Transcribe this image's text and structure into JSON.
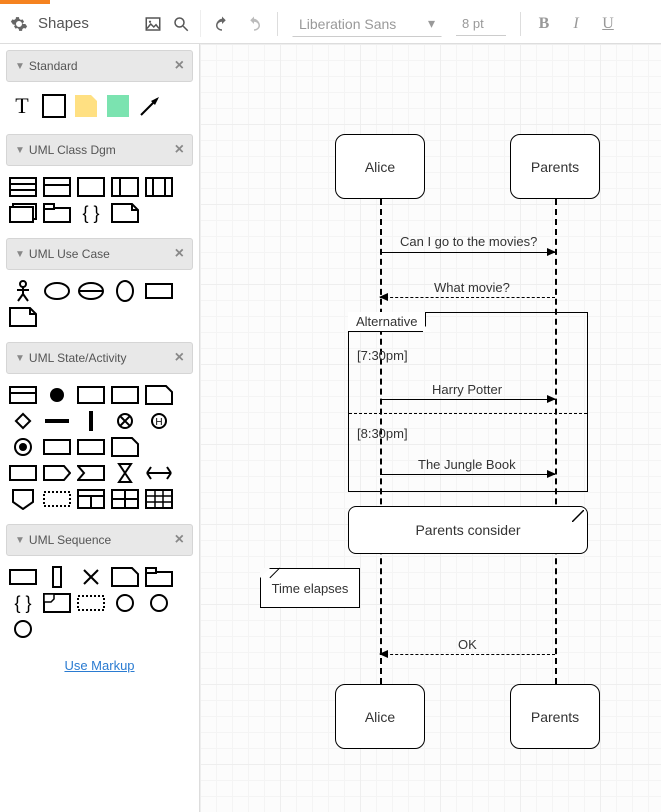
{
  "header": {
    "shapes_label": "Shapes",
    "font_name": "Liberation Sans",
    "font_size": "8 pt"
  },
  "sidebar": {
    "groups": {
      "standard": "Standard",
      "uml_class": "UML Class Dgm",
      "uml_usecase": "UML Use Case",
      "uml_state": "UML State/Activity",
      "uml_sequence": "UML Sequence"
    },
    "use_markup": "Use Markup"
  },
  "diagram": {
    "actor1": "Alice",
    "actor2": "Parents",
    "msg1": "Can I go to the movies?",
    "msg2": "What movie?",
    "alt_label": "Alternative",
    "guard1": "[7:30pm]",
    "opt1": "Harry Potter",
    "guard2": "[8:30pm]",
    "opt2": "The Jungle Book",
    "consider": "Parents consider",
    "time": "Time elapses",
    "msg3": "OK",
    "actor1b": "Alice",
    "actor2b": "Parents"
  }
}
